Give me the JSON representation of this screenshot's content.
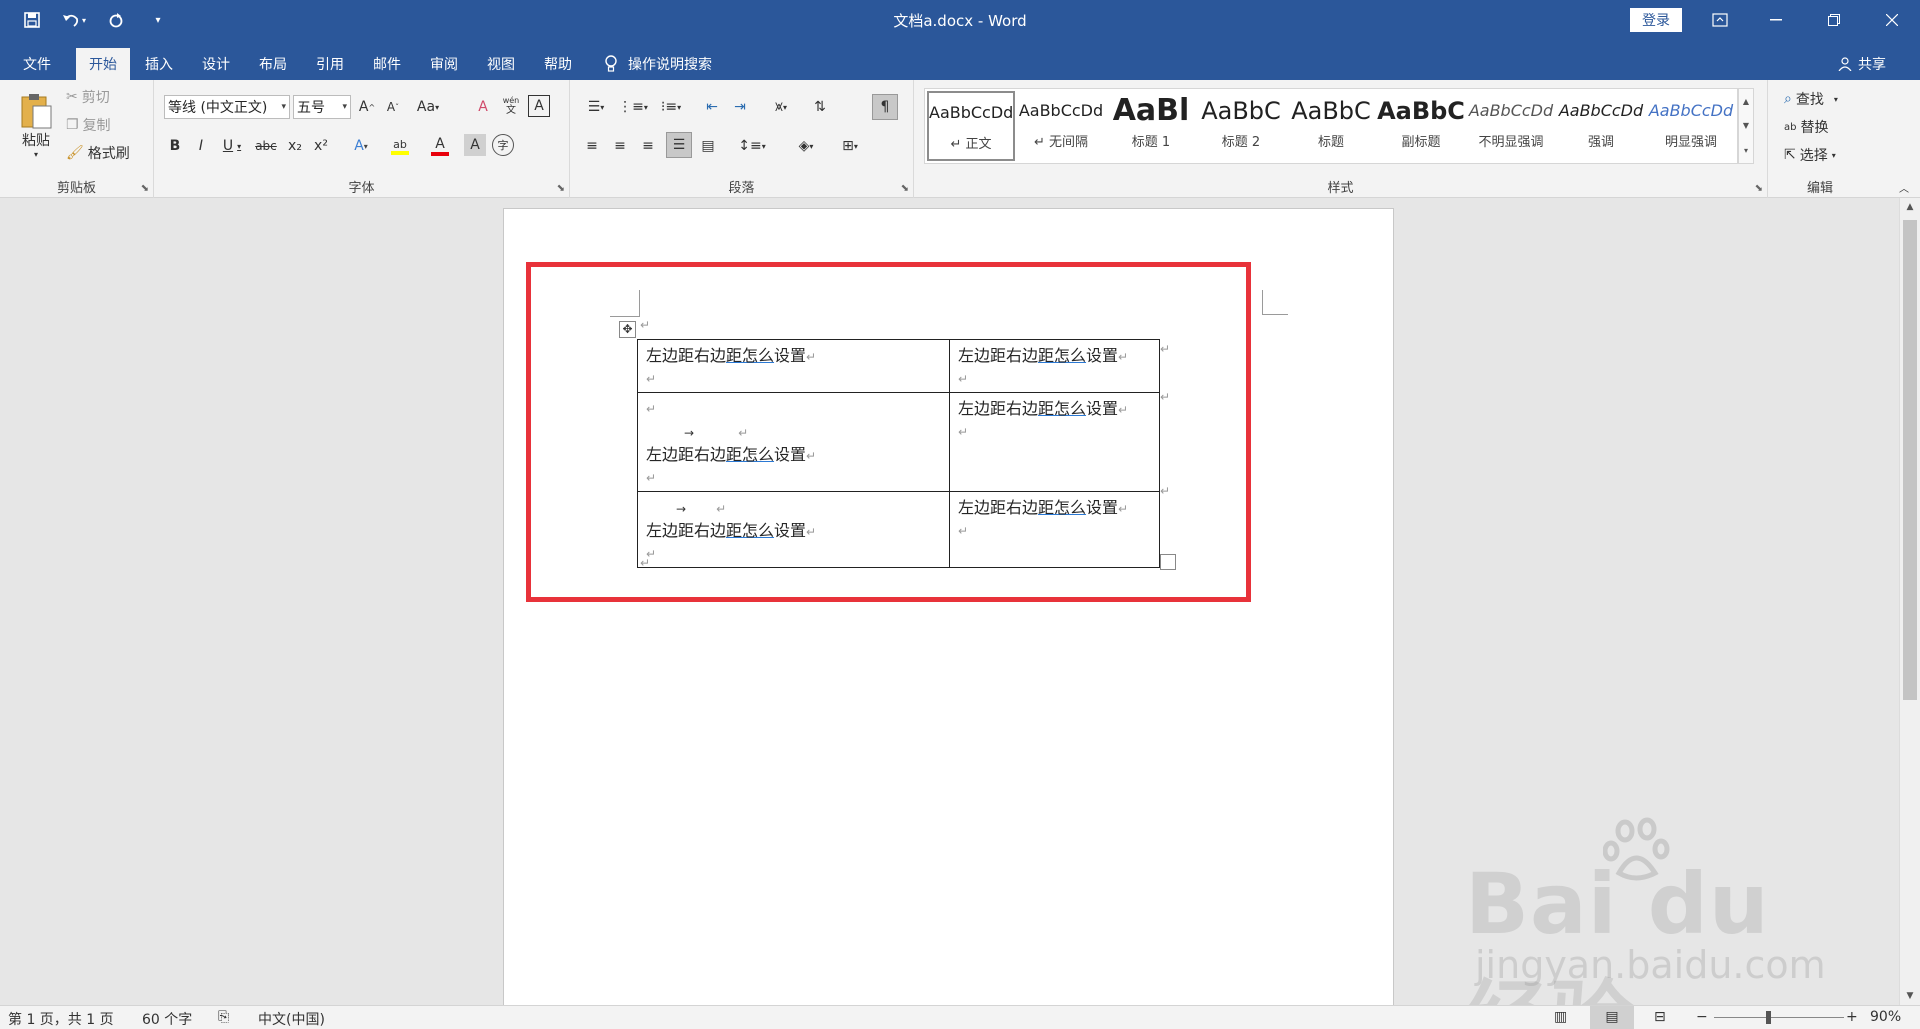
{
  "titlebar": {
    "doc_title": "文档a.docx  -  Word",
    "login_label": "登录",
    "qat": [
      "save-icon",
      "undo-icon",
      "redo-icon",
      "customize-icon"
    ]
  },
  "tabs": [
    {
      "label": "文件"
    },
    {
      "label": "开始"
    },
    {
      "label": "插入"
    },
    {
      "label": "设计"
    },
    {
      "label": "布局"
    },
    {
      "label": "引用"
    },
    {
      "label": "邮件"
    },
    {
      "label": "审阅"
    },
    {
      "label": "视图"
    },
    {
      "label": "帮助"
    }
  ],
  "tellme": "操作说明搜索",
  "share": "共享",
  "clipboard": {
    "paste": "粘贴",
    "cut": "剪切",
    "copy": "复制",
    "format_painter": "格式刷",
    "label": "剪贴板"
  },
  "font": {
    "font_name": "等线 (中文正文)",
    "font_size": "五号",
    "label": "字体",
    "grow": "A",
    "shrink": "A",
    "case": "Aa",
    "bold": "B",
    "italic": "I",
    "underline": "U",
    "strike": "abc",
    "sub": "x₂",
    "sup": "x²",
    "effect": "A",
    "highlight": "ab",
    "color": "A",
    "shade": "A",
    "phonetic": "wén",
    "border_char": "A"
  },
  "paragraph": {
    "label": "段落"
  },
  "styles": {
    "label": "样式",
    "items": [
      {
        "preview": "AaBbCcDd",
        "name": "↵ 正文"
      },
      {
        "preview": "AaBbCcDd",
        "name": "↵ 无间隔"
      },
      {
        "preview": "AaBl",
        "name": "标题 1"
      },
      {
        "preview": "AaBbC",
        "name": "标题 2"
      },
      {
        "preview": "AaBbC",
        "name": "标题"
      },
      {
        "preview": "AaBbC",
        "name": "副标题"
      },
      {
        "preview": "AaBbCcDd",
        "name": "不明显强调"
      },
      {
        "preview": "AaBbCcDd",
        "name": "强调"
      },
      {
        "preview": "AaBbCcDd",
        "name": "明显强调"
      }
    ]
  },
  "editing": {
    "find": "查找",
    "replace": "替换",
    "select": "选择",
    "label": "编辑"
  },
  "document": {
    "cell_text": "左边距右边距怎么设置",
    "cell_underlined": "距怎么",
    "cell_prefix": "左边距右边",
    "cell_suffix": "设置",
    "para_mark": "↵",
    "tab_mark": "→"
  },
  "status": {
    "page": "第 1 页，共 1 页",
    "words": "60 个字",
    "language": "中文(中国)",
    "zoom": "90%"
  },
  "watermark": {
    "text": "Bai du 经验",
    "url": "jingyan.baidu.com"
  },
  "colors": {
    "title_bar": "#2b579a",
    "highlight_box": "#e8323a"
  }
}
